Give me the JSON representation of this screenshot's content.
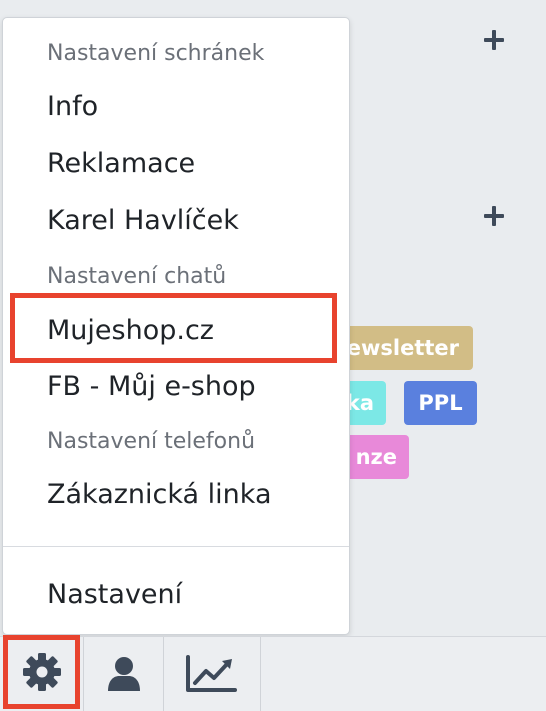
{
  "menu": {
    "mailbox_settings_header": "Nastavení schránek",
    "mailboxes": [
      "Info",
      "Reklamace",
      "Karel Havlíček"
    ],
    "chat_settings_header": "Nastavení chatů",
    "chats": [
      "Mujeshop.cz",
      "FB - Můj e-shop"
    ],
    "phone_settings_header": "Nastavení telefonů",
    "phones": [
      "Zákaznická linka"
    ],
    "settings_label": "Nastavení"
  },
  "tags": {
    "newsletter": "ewsletter",
    "cyan": "ka",
    "ppl": "PPL",
    "pink": "nze"
  },
  "bottom_bar": {
    "icons": [
      "gear-icon",
      "user-icon",
      "chart-line-icon"
    ]
  },
  "colors": {
    "highlight": "#e8432e",
    "tag_newsletter": "#d2bd86",
    "tag_cyan": "#7ce8e6",
    "tag_ppl": "#5a80de",
    "tag_pink": "#e889d9",
    "icon": "#3e4a5a"
  }
}
